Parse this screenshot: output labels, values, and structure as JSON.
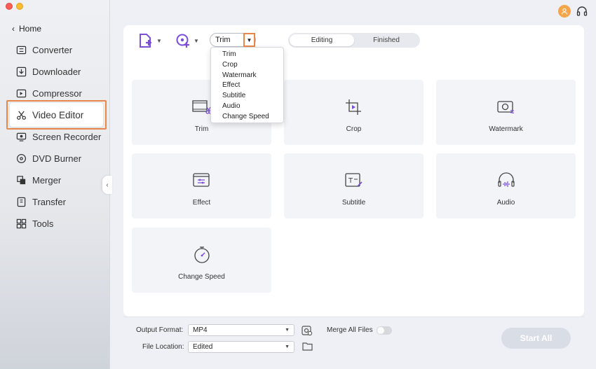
{
  "colors": {
    "accent": "#e8874a",
    "purple": "#7b4fd6",
    "sidebar_bg": "#eef0f3",
    "tile_bg": "#f3f4f8"
  },
  "sidebar": {
    "home_label": "Home",
    "items": [
      {
        "label": "Converter",
        "icon": "converter-icon"
      },
      {
        "label": "Downloader",
        "icon": "downloader-icon"
      },
      {
        "label": "Compressor",
        "icon": "compressor-icon"
      },
      {
        "label": "Video Editor",
        "icon": "scissors-icon",
        "active": true
      },
      {
        "label": "Screen Recorder",
        "icon": "screen-recorder-icon"
      },
      {
        "label": "DVD Burner",
        "icon": "dvd-icon"
      },
      {
        "label": "Merger",
        "icon": "merger-icon"
      },
      {
        "label": "Transfer",
        "icon": "transfer-icon"
      },
      {
        "label": "Tools",
        "icon": "tools-icon"
      }
    ]
  },
  "toolbar": {
    "edit_select_value": "Trim",
    "tabs": [
      {
        "label": "Editing",
        "active": true
      },
      {
        "label": "Finished",
        "active": false
      }
    ]
  },
  "dropdown": {
    "options": [
      "Trim",
      "Crop",
      "Watermark",
      "Effect",
      "Subtitle",
      "Audio",
      "Change Speed"
    ]
  },
  "tiles": [
    {
      "label": "Trim",
      "icon": "trim-icon"
    },
    {
      "label": "Crop",
      "icon": "crop-icon"
    },
    {
      "label": "Watermark",
      "icon": "watermark-icon"
    },
    {
      "label": "Effect",
      "icon": "effect-icon"
    },
    {
      "label": "Subtitle",
      "icon": "subtitle-icon"
    },
    {
      "label": "Audio",
      "icon": "audio-icon"
    },
    {
      "label": "Change Speed",
      "icon": "speed-icon"
    }
  ],
  "bottom": {
    "output_format_label": "Output Format:",
    "output_format_value": "MP4",
    "file_location_label": "File Location:",
    "file_location_value": "Edited",
    "merge_label": "Merge All Files",
    "merge_on": false,
    "start_all_label": "Start All"
  }
}
